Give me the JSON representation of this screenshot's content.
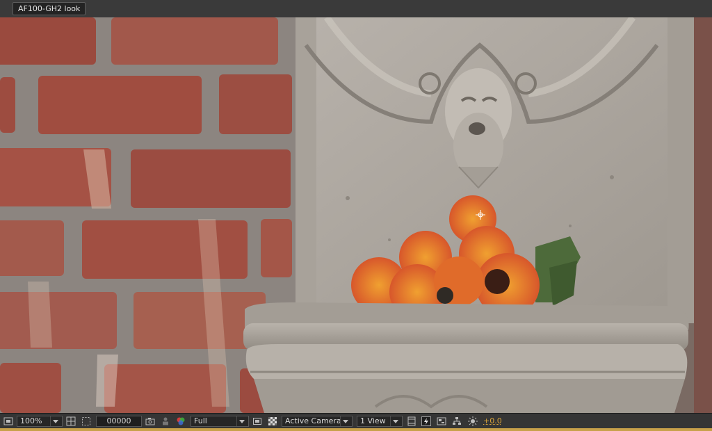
{
  "composition_tab": {
    "title": "AF100-GH2 look"
  },
  "viewer": {
    "content": "footage"
  },
  "toolbar": {
    "zoom": "100%",
    "timecode": "00000",
    "resolution": "Full",
    "camera_view": "Active Camera",
    "view_layout": "1 View",
    "exposure": "+0.0"
  },
  "colors": {
    "exposure_text": "#d9a33a",
    "accent_line": "#c8a14a"
  }
}
